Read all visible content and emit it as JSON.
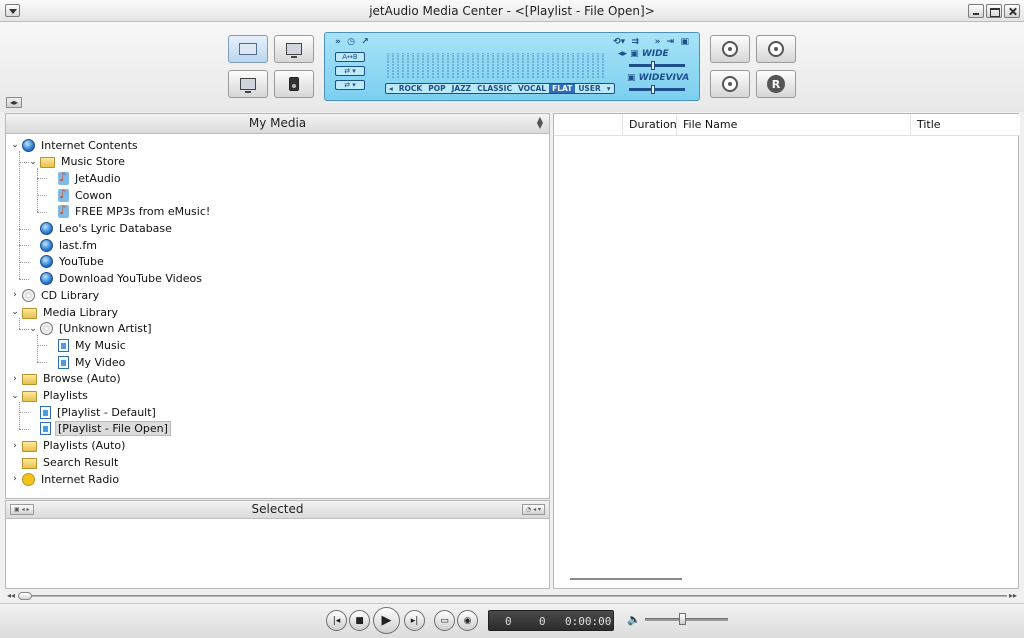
{
  "window": {
    "title": "jetAudio Media Center - <[Playlist - File Open]>"
  },
  "lcd": {
    "ab_label": "A↔B",
    "eq_presets": [
      "ROCK",
      "POP",
      "JAZZ",
      "CLASSIC",
      "VOCAL",
      "FLAT",
      "USER"
    ],
    "eq_selected": "FLAT",
    "fx1": "WIDE",
    "fx2": "WIDEVIVA"
  },
  "left_panel": {
    "title": "My Media",
    "tree": [
      {
        "label": "Internet Contents",
        "icon": "globe",
        "level": 0,
        "expanded": true
      },
      {
        "label": "Music Store",
        "icon": "folder",
        "level": 1,
        "expanded": true
      },
      {
        "label": "JetAudio",
        "icon": "note",
        "level": 2
      },
      {
        "label": "Cowon",
        "icon": "note",
        "level": 2
      },
      {
        "label": "FREE MP3s from eMusic!",
        "icon": "note",
        "level": 2
      },
      {
        "label": "Leo's Lyric Database",
        "icon": "globe",
        "level": 1
      },
      {
        "label": "last.fm",
        "icon": "globe",
        "level": 1
      },
      {
        "label": "YouTube",
        "icon": "globe",
        "level": 1
      },
      {
        "label": "Download YouTube Videos",
        "icon": "globe",
        "level": 1
      },
      {
        "label": "CD Library",
        "icon": "cd",
        "level": 0,
        "expanded": false
      },
      {
        "label": "Media Library",
        "icon": "folder",
        "level": 0,
        "expanded": true
      },
      {
        "label": "[Unknown Artist]",
        "icon": "cd",
        "level": 1,
        "expanded": true
      },
      {
        "label": "My Music",
        "icon": "doc",
        "level": 2
      },
      {
        "label": "My Video",
        "icon": "doc",
        "level": 2
      },
      {
        "label": "Browse (Auto)",
        "icon": "folder",
        "level": 0,
        "expanded": false
      },
      {
        "label": "Playlists",
        "icon": "folder",
        "level": 0,
        "expanded": true
      },
      {
        "label": "[Playlist - Default]",
        "icon": "doc",
        "level": 1
      },
      {
        "label": "[Playlist - File Open]",
        "icon": "doc",
        "level": 1,
        "selected": true
      },
      {
        "label": "Playlists (Auto)",
        "icon": "folder",
        "level": 0,
        "expanded": false
      },
      {
        "label": "Search Result",
        "icon": "search",
        "level": 0
      },
      {
        "label": "Internet Radio",
        "icon": "radio",
        "level": 0,
        "expanded": false
      }
    ]
  },
  "selected_panel": {
    "title": "Selected"
  },
  "playlist": {
    "columns": [
      "Duration",
      "File Name",
      "Title"
    ]
  },
  "transport": {
    "time_a": "0",
    "time_b": "0",
    "time_c": "0:00:00",
    "seek_fraction": 0,
    "volume_fraction": 0.45
  }
}
